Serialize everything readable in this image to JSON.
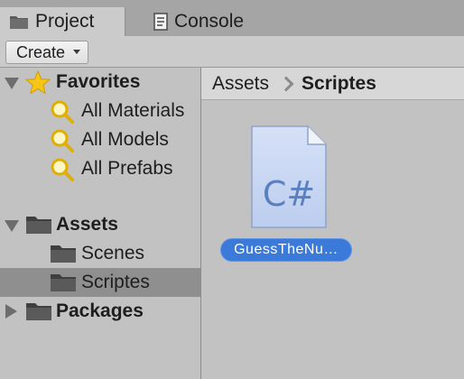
{
  "tabs": [
    {
      "label": "Project",
      "icon": "folder-icon",
      "active": true
    },
    {
      "label": "Console",
      "icon": "console-icon",
      "active": false
    }
  ],
  "toolbar": {
    "create_label": "Create"
  },
  "tree": {
    "favorites": {
      "label": "Favorites",
      "expanded": true,
      "items": [
        {
          "label": "All Materials",
          "icon": "search-icon"
        },
        {
          "label": "All Models",
          "icon": "search-icon"
        },
        {
          "label": "All Prefabs",
          "icon": "search-icon"
        }
      ]
    },
    "assets": {
      "label": "Assets",
      "expanded": true,
      "children": [
        {
          "label": "Scenes",
          "selected": false
        },
        {
          "label": "Scriptes",
          "selected": true
        }
      ]
    },
    "packages": {
      "label": "Packages",
      "expanded": false
    }
  },
  "breadcrumb": [
    "Assets",
    "Scriptes"
  ],
  "files": [
    {
      "name": "GuessTheNu…",
      "icon_text": "C#",
      "icon": "csharp-file-icon",
      "selected": true
    }
  ],
  "colors": {
    "selection_blue": "#3b7ad9",
    "tree_selection": "#8f8f8f",
    "star_yellow": "#f5c518",
    "csharp_blue": "#5a80c0"
  }
}
